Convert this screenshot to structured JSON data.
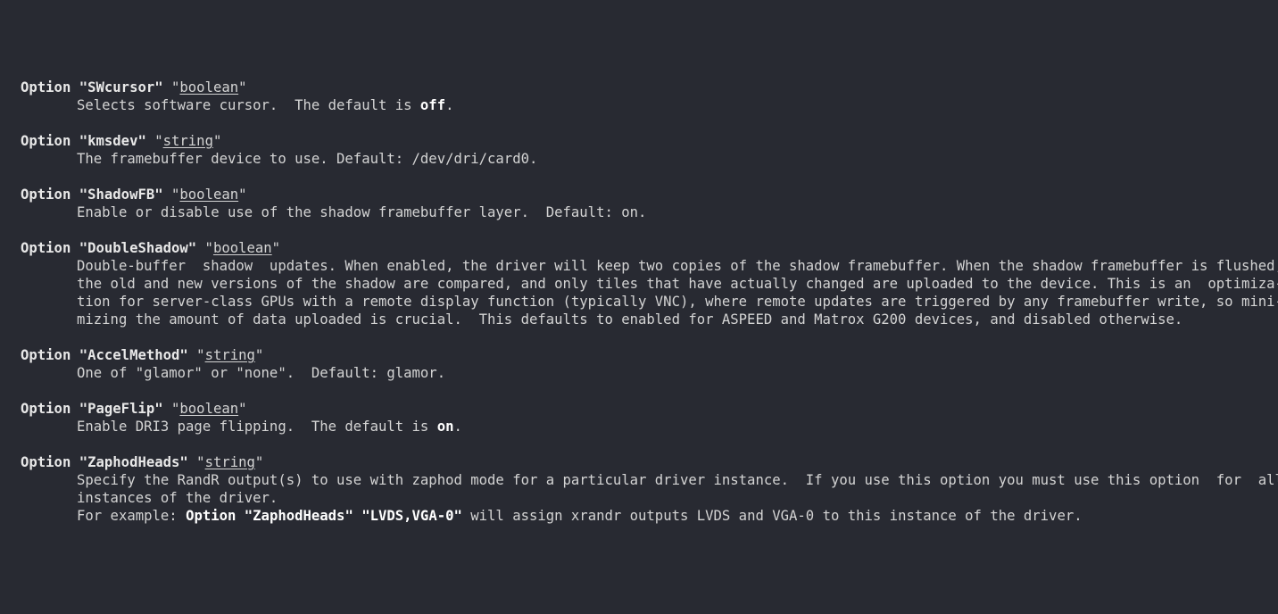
{
  "options": [
    {
      "keyword": "Option",
      "name": "\"SWcursor\"",
      "type": "boolean",
      "lines": [
        {
          "parts": [
            {
              "t": "Selects software cursor.  The default is "
            },
            {
              "t": "off",
              "b": true
            },
            {
              "t": "."
            }
          ]
        }
      ]
    },
    {
      "keyword": "Option",
      "name": "\"kmsdev\"",
      "type": "string",
      "lines": [
        {
          "parts": [
            {
              "t": "The framebuffer device to use. Default: /dev/dri/card0."
            }
          ]
        }
      ]
    },
    {
      "keyword": "Option",
      "name": "\"ShadowFB\"",
      "type": "boolean",
      "lines": [
        {
          "parts": [
            {
              "t": "Enable or disable use of the shadow framebuffer layer.  Default: on."
            }
          ]
        }
      ]
    },
    {
      "keyword": "Option",
      "name": "\"DoubleShadow\"",
      "type": "boolean",
      "lines": [
        {
          "parts": [
            {
              "t": "Double-buffer  shadow  updates. When enabled, the driver will keep two copies of the shadow framebuffer. When the shadow framebuffer is flushed,"
            }
          ]
        },
        {
          "parts": [
            {
              "t": "the old and new versions of the shadow are compared, and only tiles that have actually changed are uploaded to the device. This is an  optimiza-"
            }
          ]
        },
        {
          "parts": [
            {
              "t": "tion for server-class GPUs with a remote display function (typically VNC), where remote updates are triggered by any framebuffer write, so mini-"
            }
          ]
        },
        {
          "parts": [
            {
              "t": "mizing the amount of data uploaded is crucial.  This defaults to enabled for ASPEED and Matrox G200 devices, and disabled otherwise."
            }
          ]
        }
      ]
    },
    {
      "keyword": "Option",
      "name": "\"AccelMethod\"",
      "type": "string",
      "lines": [
        {
          "parts": [
            {
              "t": "One of \"glamor\" or \"none\".  Default: glamor."
            }
          ]
        }
      ]
    },
    {
      "keyword": "Option",
      "name": "\"PageFlip\"",
      "type": "boolean",
      "lines": [
        {
          "parts": [
            {
              "t": "Enable DRI3 page flipping.  The default is "
            },
            {
              "t": "on",
              "b": true
            },
            {
              "t": "."
            }
          ]
        }
      ]
    },
    {
      "keyword": "Option",
      "name": "\"ZaphodHeads\"",
      "type": "string",
      "lines": [
        {
          "parts": [
            {
              "t": "Specify the RandR output(s) to use with zaphod mode for a particular driver instance.  If you use this option you must use this option  for  all"
            }
          ]
        },
        {
          "parts": [
            {
              "t": "instances of the driver."
            }
          ]
        },
        {
          "parts": [
            {
              "t": "For example: "
            },
            {
              "t": "Option \"ZaphodHeads\" \"LVDS,VGA-0\"",
              "b": true
            },
            {
              "t": " will assign xrandr outputs LVDS and VGA-0 to this instance of the driver."
            }
          ]
        }
      ]
    }
  ]
}
